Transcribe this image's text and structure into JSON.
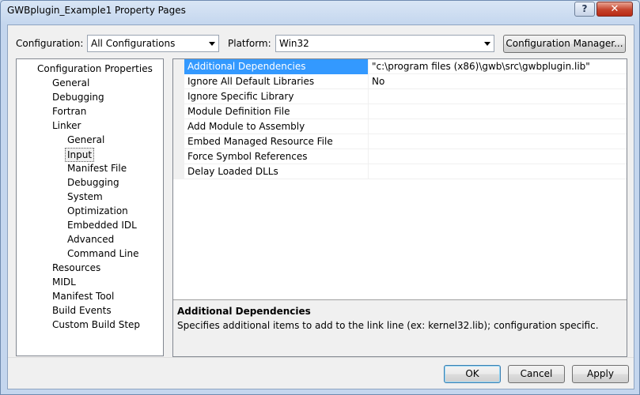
{
  "window": {
    "title": "GWBplugin_Example1 Property Pages",
    "help_glyph": "?",
    "close_glyph": "✕"
  },
  "toolbar": {
    "configuration_label": "Configuration:",
    "configuration_value": "All Configurations",
    "platform_label": "Platform:",
    "platform_value": "Win32",
    "config_manager_label": "Configuration Manager..."
  },
  "tree": {
    "items": [
      {
        "label": "Configuration Properties",
        "level": 0
      },
      {
        "label": "General",
        "level": 1
      },
      {
        "label": "Debugging",
        "level": 1
      },
      {
        "label": "Fortran",
        "level": 1
      },
      {
        "label": "Linker",
        "level": 1
      },
      {
        "label": "General",
        "level": 2
      },
      {
        "label": "Input",
        "level": 2,
        "selected": true
      },
      {
        "label": "Manifest File",
        "level": 2
      },
      {
        "label": "Debugging",
        "level": 2
      },
      {
        "label": "System",
        "level": 2
      },
      {
        "label": "Optimization",
        "level": 2
      },
      {
        "label": "Embedded IDL",
        "level": 2
      },
      {
        "label": "Advanced",
        "level": 2
      },
      {
        "label": "Command Line",
        "level": 2
      },
      {
        "label": "Resources",
        "level": 1
      },
      {
        "label": "MIDL",
        "level": 1
      },
      {
        "label": "Manifest Tool",
        "level": 1
      },
      {
        "label": "Build Events",
        "level": 1
      },
      {
        "label": "Custom Build Step",
        "level": 1
      }
    ]
  },
  "grid": {
    "rows": [
      {
        "name": "Additional Dependencies",
        "value": "\"c:\\program files (x86)\\gwb\\src\\gwbplugin.lib\"",
        "selected": true
      },
      {
        "name": "Ignore All Default Libraries",
        "value": "No"
      },
      {
        "name": "Ignore Specific Library",
        "value": ""
      },
      {
        "name": "Module Definition File",
        "value": ""
      },
      {
        "name": "Add Module to Assembly",
        "value": ""
      },
      {
        "name": "Embed Managed Resource File",
        "value": ""
      },
      {
        "name": "Force Symbol References",
        "value": ""
      },
      {
        "name": "Delay Loaded DLLs",
        "value": ""
      }
    ]
  },
  "description": {
    "title": "Additional Dependencies",
    "text": "Specifies additional items to add to the link line (ex: kernel32.lib); configuration specific."
  },
  "buttons": {
    "ok": "OK",
    "cancel": "Cancel",
    "apply": "Apply"
  }
}
